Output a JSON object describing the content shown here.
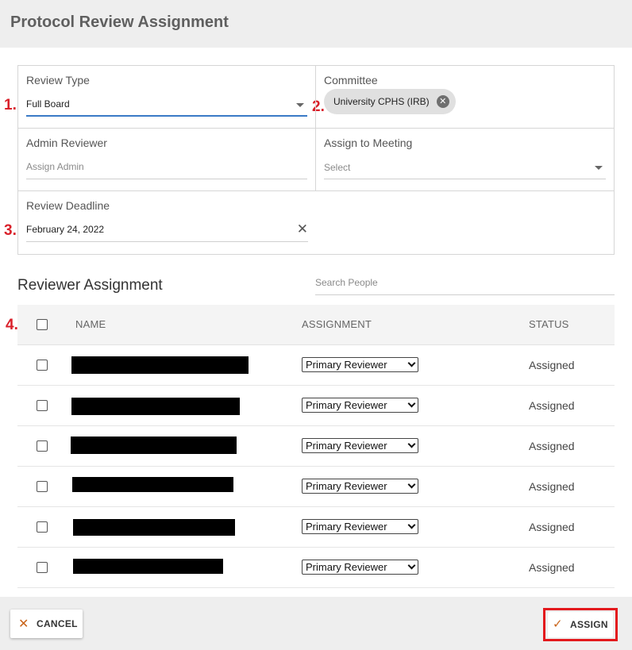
{
  "dialog": {
    "title": "Protocol Review Assignment"
  },
  "markers": [
    "1.",
    "2.",
    "3.",
    "4."
  ],
  "form": {
    "review_type": {
      "label": "Review Type",
      "value": "Full Board"
    },
    "committee": {
      "label": "Committee",
      "chip": "University CPHS (IRB)"
    },
    "admin_reviewer": {
      "label": "Admin Reviewer",
      "placeholder": "Assign Admin"
    },
    "assign_meeting": {
      "label": "Assign to Meeting",
      "placeholder": "Select"
    },
    "review_deadline": {
      "label": "Review Deadline",
      "value": "February 24, 2022"
    }
  },
  "reviewers": {
    "title": "Reviewer Assignment",
    "search_placeholder": "Search People",
    "columns": {
      "name": "NAME",
      "assignment": "ASSIGNMENT",
      "status": "STATUS"
    },
    "rows": [
      {
        "assignment": "Primary Reviewer",
        "status": "Assigned"
      },
      {
        "assignment": "Primary Reviewer",
        "status": "Assigned"
      },
      {
        "assignment": "Primary Reviewer",
        "status": "Assigned"
      },
      {
        "assignment": "Primary Reviewer",
        "status": "Assigned"
      },
      {
        "assignment": "Primary Reviewer",
        "status": "Assigned"
      },
      {
        "assignment": "Primary Reviewer",
        "status": "Assigned"
      }
    ]
  },
  "footer": {
    "cancel_label": "CANCEL",
    "assign_label": "ASSIGN"
  },
  "colors": {
    "accent_blue": "#3b7ac6",
    "icon_orange": "#c9651b",
    "highlight_red": "#e3191d",
    "marker_red": "#d9202a"
  }
}
